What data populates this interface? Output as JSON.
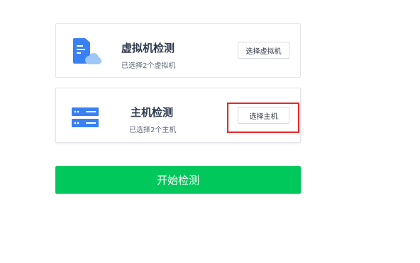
{
  "vm_card": {
    "title": "虚拟机检测",
    "subtitle": "已选择2个虚拟机",
    "button_label": "选择虚拟机"
  },
  "host_card": {
    "title": "主机检测",
    "subtitle": "已选择2个主机",
    "button_label": "选择主机"
  },
  "start_button_label": "开始检测",
  "colors": {
    "icon_blue": "#3a80f5",
    "cloud_blue": "#9ec6f7",
    "start_green": "#00c85a",
    "highlight_red": "#e4282a"
  }
}
